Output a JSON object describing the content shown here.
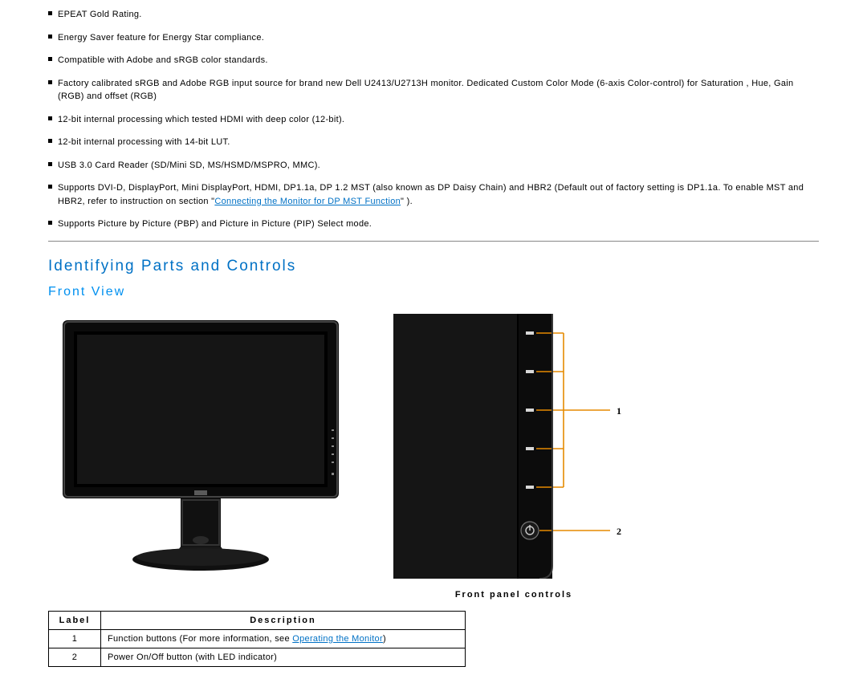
{
  "features": [
    "EPEAT Gold Rating.",
    "Energy Saver feature for Energy Star compliance.",
    "Compatible with Adobe and sRGB color standards.",
    "Factory calibrated sRGB and Adobe RGB input source for brand new Dell U2413/U2713H monitor. Dedicated Custom Color Mode (6-axis Color-control) for Saturation , Hue, Gain (RGB) and offset (RGB)",
    "12-bit internal processing which tested HDMI with deep color (12-bit).",
    "12-bit internal processing with 14-bit LUT.",
    "USB 3.0 Card Reader (SD/Mini SD, MS/HSMD/MSPRO, MMC)."
  ],
  "feature_mst_pre": "Supports DVI-D, DisplayPort, Mini DisplayPort, HDMI, DP1.1a, DP 1.2 MST (also known as DP Daisy Chain) and HBR2 (Default out of factory setting is DP1.1a. To enable MST and HBR2, refer to instruction on section \"",
  "feature_mst_link": "Connecting the Monitor for DP MST Function",
  "feature_mst_post": "\" ).",
  "feature_last": "Supports Picture by Picture (PBP) and Picture in Picture (PIP) Select mode.",
  "heading_parts": "Identifying Parts and Controls",
  "heading_front": "Front View",
  "panel_caption": "Front panel controls",
  "callout1": "1",
  "callout2": "2",
  "table": {
    "head_label": "Label",
    "head_desc": "Description",
    "row1_label": "1",
    "row1_pre": "Function buttons (For more information, see ",
    "row1_link": "Operating the Monitor",
    "row1_post": ")",
    "row2_label": "2",
    "row2_desc": "Power On/Off button (with LED indicator)"
  }
}
